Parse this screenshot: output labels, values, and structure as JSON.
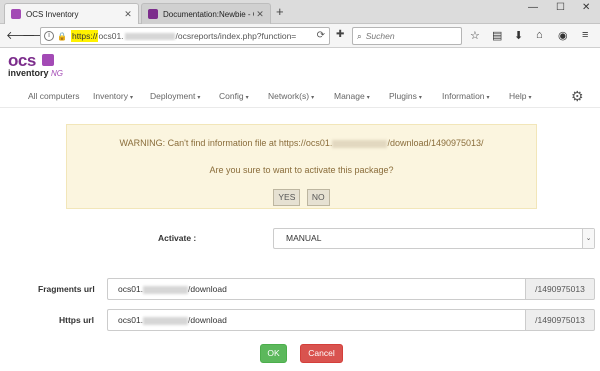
{
  "browser": {
    "tabs": [
      {
        "title": "OCS Inventory",
        "favicon_color": "#a34ab5"
      },
      {
        "title": "Documentation:Newbie - OCS...",
        "favicon_color": "#7c2d8c"
      }
    ],
    "new_tab_icon": "plus-icon",
    "url": {
      "protocol": "https://",
      "host_prefix": "ocs01.",
      "path": "/ocsreports/index.php?function="
    },
    "search_placeholder": "Suchen"
  },
  "app": {
    "logo_text": "ocs",
    "logo_subtitle": "inventory",
    "logo_ng": "NG",
    "brand_color": "#7c2d8c"
  },
  "menu": {
    "items": [
      {
        "label": "All computers",
        "has_caret": false
      },
      {
        "label": "Inventory",
        "has_caret": true
      },
      {
        "label": "Deployment",
        "has_caret": true
      },
      {
        "label": "Config",
        "has_caret": true
      },
      {
        "label": "Network(s)",
        "has_caret": true
      },
      {
        "label": "Manage",
        "has_caret": true
      },
      {
        "label": "Plugins",
        "has_caret": true
      },
      {
        "label": "Information",
        "has_caret": true
      },
      {
        "label": "Help",
        "has_caret": true
      }
    ],
    "caret": "▾"
  },
  "warning": {
    "line1_prefix": "WARNING: Can't find information file at https://ocs01.",
    "line1_suffix": "/download/1490975013/",
    "line2": "Are you sure to want to activate this package?",
    "yes_label": "YES",
    "no_label": "NO"
  },
  "form": {
    "activate_label": "Activate :",
    "activate_value": "MANUAL",
    "fragments_label": "Fragments url",
    "fragments_prefix": "ocs01.",
    "fragments_suffix": "/download",
    "fragments_addon": "/1490975013",
    "https_label": "Https url",
    "https_prefix": "ocs01.",
    "https_suffix": "/download",
    "https_addon": "/1490975013",
    "ok_label": "OK",
    "cancel_label": "Cancel"
  }
}
